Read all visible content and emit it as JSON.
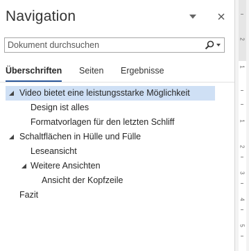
{
  "pane": {
    "title": "Navigation",
    "menu_icon": "chevron-down-icon",
    "close_icon": "close-icon"
  },
  "search": {
    "placeholder": "Dokument durchsuchen",
    "value": "",
    "icon": "search-icon"
  },
  "tabs": [
    {
      "label": "Überschriften",
      "active": true
    },
    {
      "label": "Seiten",
      "active": false
    },
    {
      "label": "Ergebnisse",
      "active": false
    }
  ],
  "headings": [
    {
      "label": "Video bietet eine leistungsstarke Möglichkeit",
      "level": 1,
      "expanded": true,
      "selected": true
    },
    {
      "label": "Design ist alles",
      "level": 2
    },
    {
      "label": "Formatvorlagen für den letzten Schliff",
      "level": 2
    },
    {
      "label": "Schaltflächen in Hülle und Fülle",
      "level": 1,
      "expanded": true
    },
    {
      "label": "Leseansicht",
      "level": 2
    },
    {
      "label": "Weitere Ansichten",
      "level": 2,
      "expanded": true
    },
    {
      "label": "Ansicht der Kopfzeile",
      "level": 3
    },
    {
      "label": "Fazit",
      "level": 1
    }
  ],
  "ruler": {
    "numbers": [
      "2",
      "1",
      "1",
      "2",
      "3",
      "4",
      "5"
    ]
  },
  "colors": {
    "selection": "#cfe0f5",
    "tab_underline": "#2b579a"
  }
}
